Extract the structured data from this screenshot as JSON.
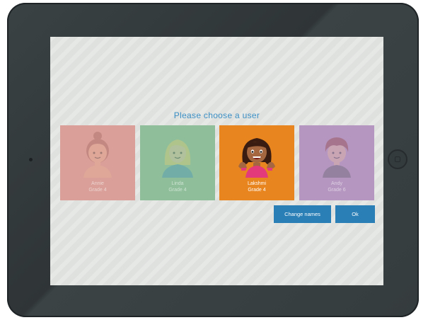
{
  "screen": {
    "title": "Please choose a user"
  },
  "users": [
    {
      "name": "Annie",
      "grade": "Grade 4",
      "color": "#d99f98",
      "selected": false
    },
    {
      "name": "Linda",
      "grade": "Grade 4",
      "color": "#8fbf9a",
      "selected": false
    },
    {
      "name": "Lakshmi",
      "grade": "Grade 4",
      "color": "#e8851f",
      "selected": true
    },
    {
      "name": "Andy",
      "grade": "Grade 6",
      "color": "#b596c0",
      "selected": false
    }
  ],
  "buttons": {
    "change_names": "Change names",
    "ok": "Ok"
  },
  "colors": {
    "accent": "#2a7fb6",
    "title": "#3b8fc4",
    "screen_bg": "#dfe1df",
    "device": "#343b3d"
  }
}
